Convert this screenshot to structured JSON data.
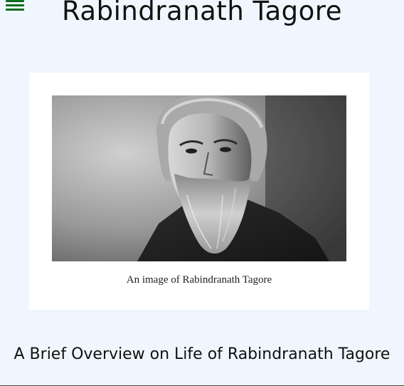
{
  "header": {
    "menu_icon": "hamburger-menu-icon",
    "title": "Rabindranath Tagore"
  },
  "figure": {
    "image_alt": "An image of Rabindranath Tagore",
    "caption": "An image of Rabindranath Tagore"
  },
  "section": {
    "heading": "A Brief Overview on Life of Rabindranath Tagore"
  },
  "colors": {
    "background": "#eff6fd",
    "menu_icon": "#0b6e1f",
    "card": "#ffffff",
    "text": "#111111"
  }
}
